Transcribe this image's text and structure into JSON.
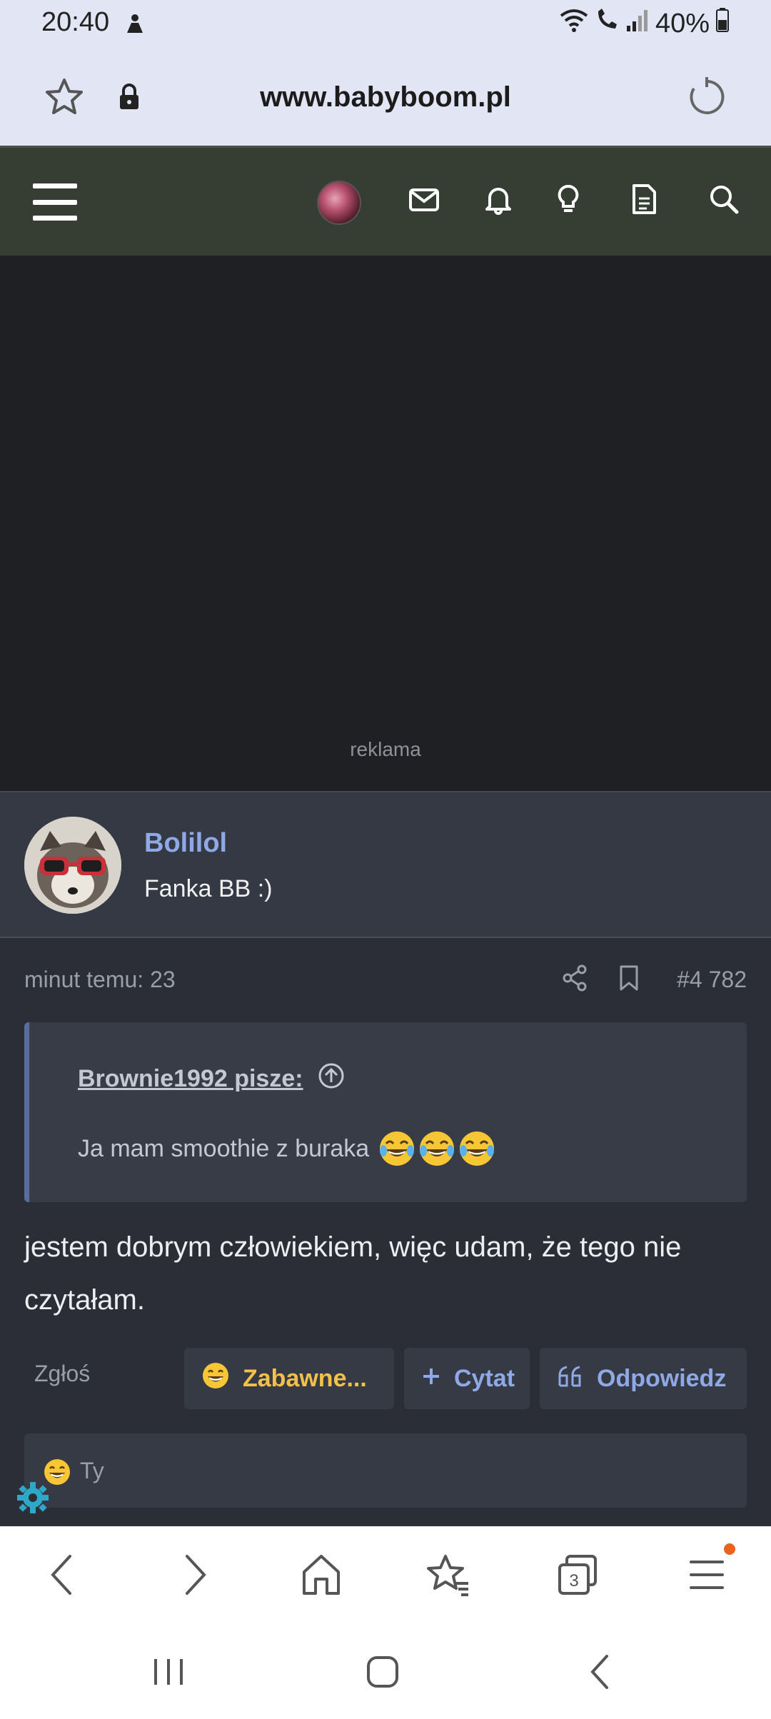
{
  "status_bar": {
    "time": "20:40",
    "battery": "40%"
  },
  "url_bar": {
    "url": "www.babyboom.pl"
  },
  "ad": {
    "label": "reklama"
  },
  "post": {
    "author_name": "Bolilol",
    "author_title": "Fanka BB :)",
    "time": "minut temu: 23",
    "post_number": "#4 782",
    "quote": {
      "author": "Brownie1992 pisze:",
      "text": "Ja mam smoothie z buraka"
    },
    "body": "jestem dobrym człowiekiem, więc udam, że tego nie czytałam.",
    "actions": {
      "report": "Zgłoś",
      "funny": "Zabawne...",
      "quote": "Cytat",
      "reply": "Odpowiedz"
    },
    "reactions": {
      "text": "Ty"
    }
  },
  "browser_nav": {
    "tabs_count": "3"
  },
  "colors": {
    "link": "#8fa8e6",
    "funny": "#f3c04a",
    "header_bg": "#363d33",
    "post_bg": "#2b2e36"
  }
}
